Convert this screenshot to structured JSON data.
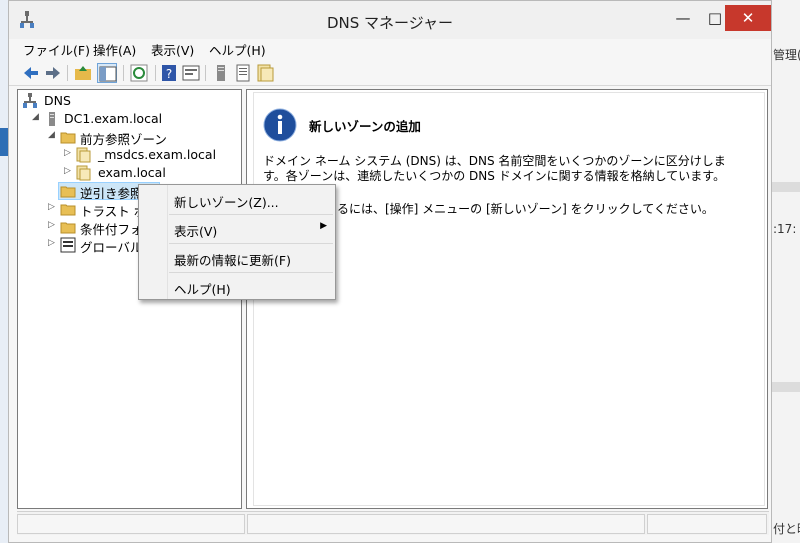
{
  "window": {
    "title": "DNS マネージャー",
    "controls": {
      "minimize": "—",
      "maximize": "□",
      "close": "✕"
    }
  },
  "menu": [
    "ファイル(F)",
    "操作(A)",
    "表示(V)",
    "ヘルプ(H)"
  ],
  "background_app": {
    "snippets": [
      "管理(",
      ":17:",
      "付と時"
    ]
  },
  "tree": {
    "root": "DNS",
    "server": "DC1.exam.local",
    "forward": "前方参照ゾーン",
    "zones": [
      "_msdcs.exam.local",
      "exam.local"
    ],
    "reverse": "逆引き参照ゾーン",
    "trust": "トラスト ポイント",
    "conditional": "条件付フォワーダー",
    "global": "グローバル ログ"
  },
  "detail": {
    "title": "新しいゾーンの追加",
    "text": "ドメイン ネーム システム (DNS) は、DNS 名前空間をいくつかのゾーンに区分けします。各ゾーンは、連続したいくつかの DNS ドメインに関する情報を格納しています。",
    "instruction": "るには、[操作] メニューの [新しいゾーン] をクリックしてください。"
  },
  "context_menu": {
    "new_zone": "新しいゾーン(Z)...",
    "view": "表示(V)",
    "refresh": "最新の情報に更新(F)",
    "help": "ヘルプ(H)"
  },
  "colors": {
    "close_button": "#c7382c",
    "selection": "#cde6f7",
    "info_blue": "#1f4e9c"
  }
}
